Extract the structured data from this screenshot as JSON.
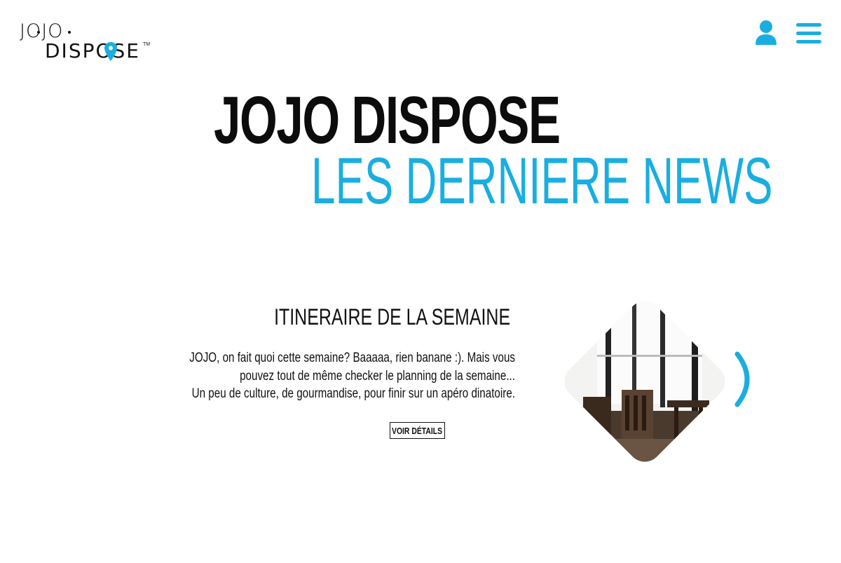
{
  "header": {
    "logo": {
      "line1": "JOJO",
      "line2": "DISPOSE",
      "tm": "TM"
    },
    "user_icon": "user-icon",
    "menu_icon": "hamburger-menu-icon"
  },
  "hero": {
    "title": "JOJO DISPOSE",
    "subtitle": "LES DERNIERE NEWS"
  },
  "news": {
    "title": "ITINERAIRE DE LA SEMAINE",
    "body_lines": [
      "JOJO, on fait quoi cette semaine? Baaaaa, rien banane :). Mais vous",
      "pouvez tout de même checker le planning de la semaine...",
      "Un peu de culture, de gourmandise, pour finir sur un apéro dinatoire."
    ],
    "details_label": "VOIR DÉTAILS",
    "image_icon": "restaurant-interior-photo",
    "next_icon": "chevron-right-icon"
  },
  "colors": {
    "accent": "#1aaee0",
    "text": "#111111",
    "background": "#ffffff"
  }
}
